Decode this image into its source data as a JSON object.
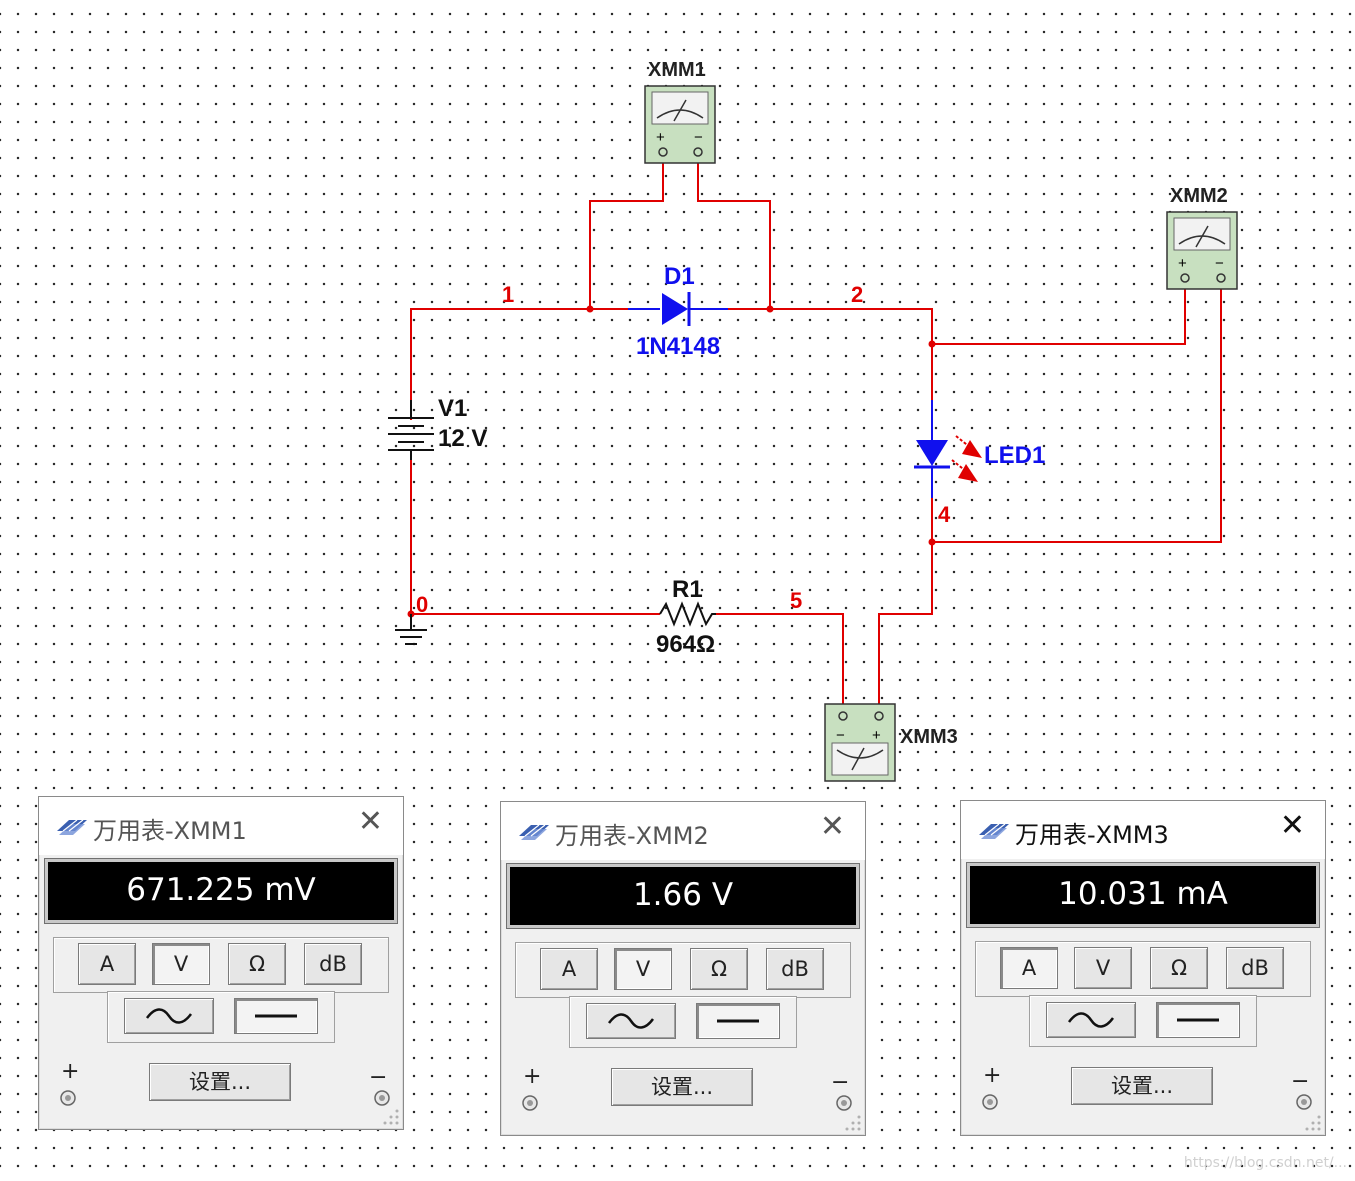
{
  "schematic": {
    "nodes": [
      "0",
      "1",
      "2",
      "4",
      "5"
    ],
    "source": {
      "name": "V1",
      "value": "12 V"
    },
    "diode": {
      "name": "D1",
      "model": "1N4148"
    },
    "led": {
      "name": "LED1"
    },
    "resistor": {
      "name": "R1",
      "value": "964Ω"
    },
    "meters": [
      "XMM1",
      "XMM2",
      "XMM3"
    ],
    "wire_color": "#e00000",
    "component_color": "#1010ee"
  },
  "panels": [
    {
      "title": "万用表-XMM1",
      "reading": "671.225 mV",
      "buttons": [
        "A",
        "V",
        "Ω",
        "dB"
      ],
      "selected_mode": "V",
      "settings_label": "设置...",
      "plus": "+",
      "minus": "−"
    },
    {
      "title": "万用表-XMM2",
      "reading": "1.66 V",
      "buttons": [
        "A",
        "V",
        "Ω",
        "dB"
      ],
      "selected_mode": "V",
      "settings_label": "设置...",
      "plus": "+",
      "minus": "−"
    },
    {
      "title": "万用表-XMM3",
      "reading": "10.031 mA",
      "buttons": [
        "A",
        "V",
        "Ω",
        "dB"
      ],
      "selected_mode": "A",
      "settings_label": "设置...",
      "plus": "+",
      "minus": "−"
    }
  ],
  "icons": {
    "close": "close-icon",
    "logo": "multisim-logo-icon",
    "ac": "ac-wave-icon",
    "dc": "dc-line-icon",
    "terminal": "terminal-icon"
  },
  "watermark": "https://blog.csdn.net/..."
}
